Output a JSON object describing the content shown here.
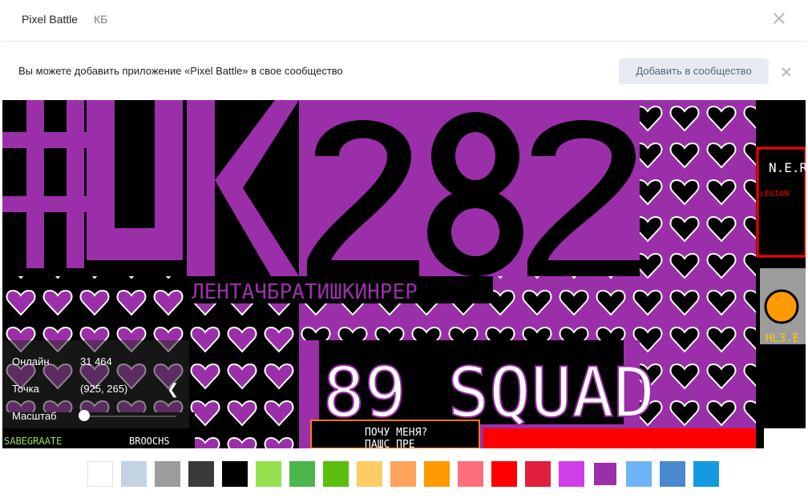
{
  "header": {
    "title": "Pixel Battle",
    "subtitle": "КБ"
  },
  "notice": {
    "text": "Вы можете добавить приложение «Pixel Battle» в свое сообщество",
    "button_label": "Добавить в сообщество"
  },
  "info": {
    "online_label": "Онлайн",
    "online_value": "31 464",
    "point_label": "Точка",
    "point_value": "(925, 265)",
    "zoom_label": "Масштаб",
    "collapse_glyph": "❮",
    "zoom_level": 0
  },
  "canvas": {
    "big_text": "ЧУК282",
    "slogan": "ЛЕНТАЧБРАТИШКИНРЕР",
    "squad": "89 SQUAD",
    "small_text_1": "ПОЧУ МЕНЯ?",
    "small_text_2": "ПАШС ПРЕ",
    "corner_text_1": "N.E.R",
    "corner_text_2": "LEGION",
    "corner_text_3": "HL3.E",
    "footer_left": "SABEGRAATE",
    "footer_mid": "BROOCHS"
  },
  "palette": {
    "colors": [
      "#ffffff",
      "#c2d3e3",
      "#9c9c9c",
      "#3a3a3a",
      "#000000",
      "#96e04f",
      "#4cb64c",
      "#5dbd0e",
      "#ffcc66",
      "#ffa35c",
      "#ff9a00",
      "#ff6f7b",
      "#ff0000",
      "#e0203d",
      "#cf3ee8",
      "#9b2fa9",
      "#6fb4f5",
      "#4a88d1",
      "#1599e1"
    ],
    "selected_index": 15
  }
}
